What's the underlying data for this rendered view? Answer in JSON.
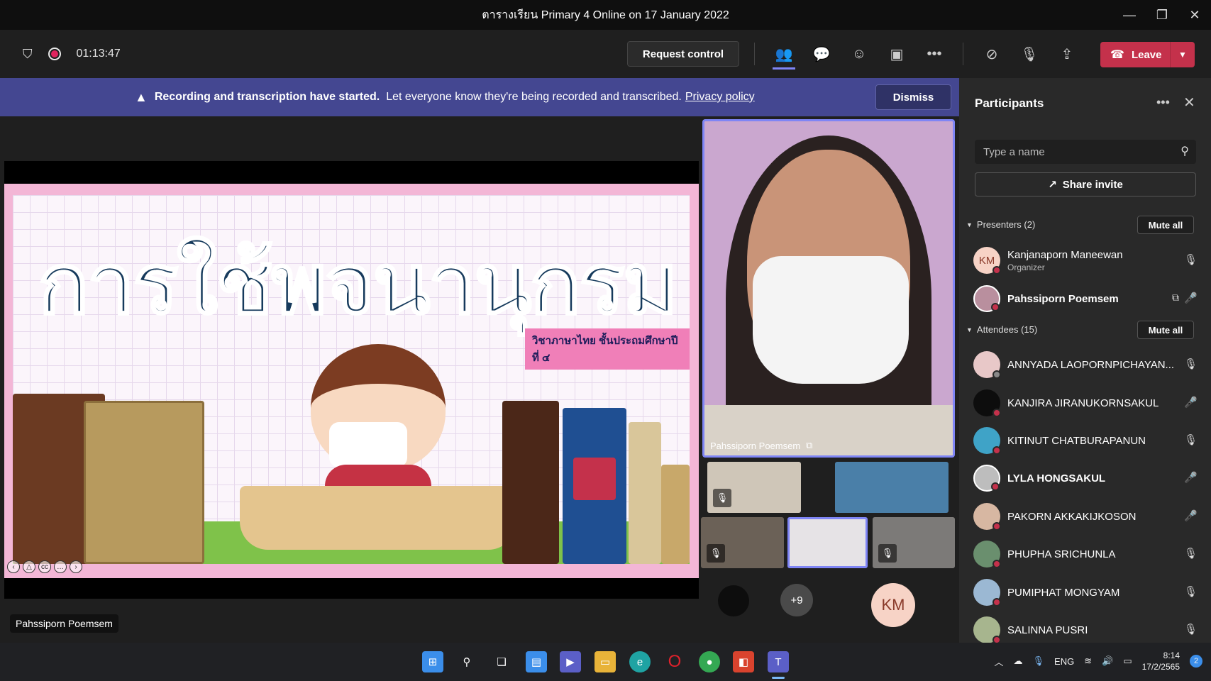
{
  "window": {
    "title": "ตารางเรียน Primary 4 Online on 17 January 2022",
    "controls": [
      "—",
      "❐",
      "✕"
    ]
  },
  "toolbar": {
    "timer": "01:13:47",
    "request_control": "Request control",
    "leave": "Leave"
  },
  "banner": {
    "bold_text": "Recording and transcription have started.",
    "message": "Let everyone know they're being recorded and transcribed.",
    "link": "Privacy policy",
    "dismiss": "Dismiss"
  },
  "share": {
    "presenter_tag": "Pahssiporn Poemsem",
    "slide_title": "การใช้พจนานุกรม",
    "slide_subtitle": "วิชาภาษาไทย ชั้นประถมศึกษาปีที่ ๔"
  },
  "gallery": {
    "spotlight_name": "Pahssiporn Poemsem",
    "overflow_count": "+9",
    "initials_tile": "KM"
  },
  "participants": {
    "title": "Participants",
    "search_placeholder": "Type a name",
    "share_invite": "Share invite",
    "presenters_label": "Presenters (2)",
    "attendees_label": "Attendees (15)",
    "mute_all": "Mute all",
    "presenters": [
      {
        "name": "Kanjanaporn Maneewan",
        "role": "Organizer",
        "initials": "KM",
        "avatar_color": "#f7d3c6"
      },
      {
        "name": "Pahssiporn Poemsem",
        "role": "",
        "initials": "",
        "avatar_color": "#b98f9e"
      }
    ],
    "attendees": [
      {
        "name": "ANNYADA LAOPORNPICHAYAN...",
        "avatar_color": "#e8c8c8"
      },
      {
        "name": "KANJIRA JIRANUKORNSAKUL",
        "avatar_color": "#0d0d0d"
      },
      {
        "name": "KITINUT CHATBURAPANUN",
        "avatar_color": "#3fa3c7"
      },
      {
        "name": "LYLA HONGSAKUL",
        "avatar_color": "#bdbdbd"
      },
      {
        "name": "PAKORN AKKAKIJKOSON",
        "avatar_color": "#d7b7a2"
      },
      {
        "name": "PHUPHA SRICHUNLA",
        "avatar_color": "#6a8f6e"
      },
      {
        "name": "PUMIPHAT MONGYAM",
        "avatar_color": "#9bb8d3"
      },
      {
        "name": "SALINNA PUSRI",
        "avatar_color": "#a7b58e"
      }
    ]
  },
  "taskbar": {
    "language": "ENG",
    "time": "8:14",
    "date": "17/2/2565",
    "notification_count": "2"
  },
  "colors": {
    "accent": "#7f85f5",
    "banner": "#444791",
    "leave": "#c4314b"
  }
}
